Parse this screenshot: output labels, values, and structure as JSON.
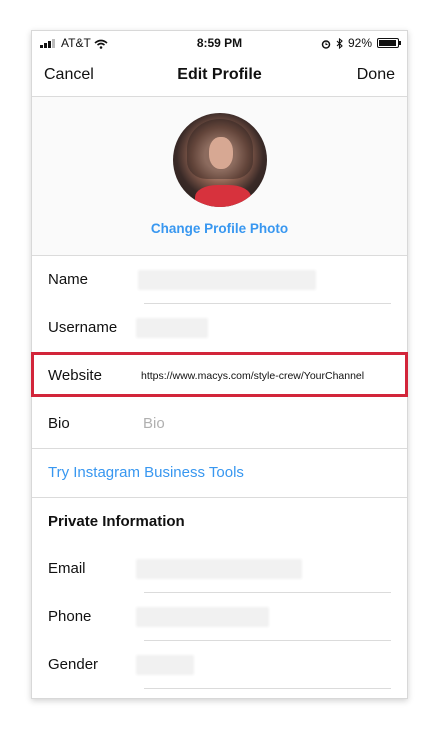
{
  "status_bar": {
    "carrier": "AT&T",
    "time": "8:59 PM",
    "battery": "92%",
    "battery_level": 0.92
  },
  "nav": {
    "cancel": "Cancel",
    "title": "Edit Profile",
    "done": "Done"
  },
  "profile_photo": {
    "change_label": "Change Profile Photo"
  },
  "fields": {
    "name": {
      "label": "Name",
      "value": ""
    },
    "username": {
      "label": "Username",
      "value": ""
    },
    "website": {
      "label": "Website",
      "value": "https://www.macys.com/style-crew/YourChannel"
    },
    "bio": {
      "label": "Bio",
      "placeholder": "Bio"
    }
  },
  "business_tools": "Try Instagram Business Tools",
  "private_info": {
    "title": "Private Information",
    "email": {
      "label": "Email",
      "value": ""
    },
    "phone": {
      "label": "Phone",
      "value": ""
    },
    "gender": {
      "label": "Gender",
      "value": ""
    }
  },
  "colors": {
    "link": "#3897f0",
    "highlight": "#d2253a"
  },
  "icons": [
    "wifi-icon",
    "alarm-icon",
    "bluetooth-icon",
    "battery-icon",
    "signal-icon"
  ]
}
